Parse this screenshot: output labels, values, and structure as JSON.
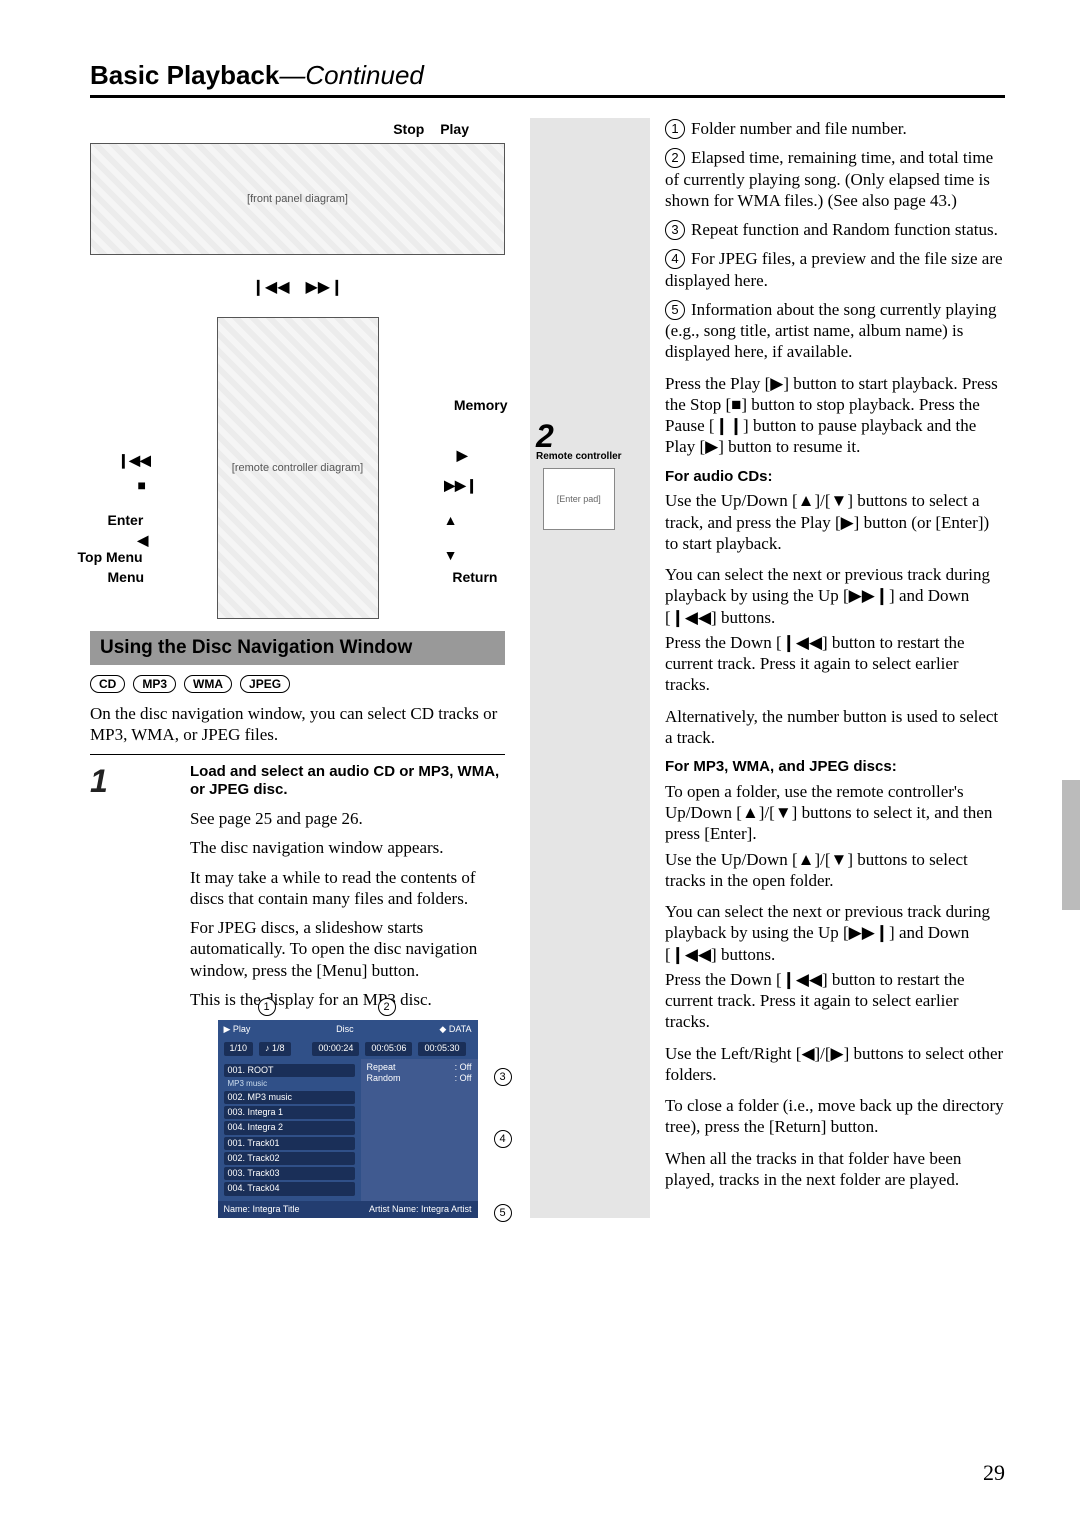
{
  "title_main": "Basic Playback",
  "title_cont": "—Continued",
  "labels": {
    "stop": "Stop",
    "play": "Play",
    "enter": "Enter",
    "top_menu": "Top Menu",
    "menu": "Menu",
    "memory": "Memory",
    "return": "Return",
    "remote_controller": "Remote controller"
  },
  "device_placeholder": "[front panel diagram]",
  "remote_placeholder": "[remote controller diagram]",
  "enter_img_placeholder": "[Enter pad]",
  "section_heading": "Using the Disc Navigation Window",
  "badges": [
    "CD",
    "MP3",
    "WMA",
    "JPEG"
  ],
  "intro": "On the disc navigation window, you can select CD tracks or MP3, WMA, or JPEG files.",
  "step1": {
    "num": "1",
    "head": "Load and select an audio CD or MP3, WMA, or JPEG disc.",
    "p1": "See page 25 and page 26.",
    "p2": "The disc navigation window appears.",
    "p3": "It may take a while to read the contents of discs that contain many files and folders.",
    "p4": "For JPEG discs, a slideshow starts automatically. To open the disc navigation window, press the [Menu] button.",
    "p5": "This is the display for an MP3 disc."
  },
  "nav_screen": {
    "top_left_play": "▶  Play",
    "top_disc": "Disc",
    "top_data": "◆ DATA",
    "track_box": "1/10",
    "file_box": "♪ 1/8",
    "time1": "00:00:24",
    "time2": "00:05:06",
    "time3": "00:05:30",
    "folder_root": "001. ROOT",
    "folder_label": "MP3 music",
    "items": [
      "002. MP3 music",
      "003. Integra 1",
      "004. Integra 2",
      "001. Track01",
      "002. Track02",
      "003. Track03",
      "004. Track04"
    ],
    "repeat_label": "Repeat",
    "repeat_val": ": Off",
    "random_label": "Random",
    "random_val": ": Off",
    "bottom_name": "Name: Integra Title",
    "bottom_artist": "Artist Name: Integra Artist"
  },
  "callouts": {
    "c1": "Folder number and file number.",
    "c2": "Elapsed time, remaining time, and total time of currently playing song. (Only elapsed time is shown for WMA files.) (See also page 43.)",
    "c3": "Repeat function and Random function status.",
    "c4": "For JPEG files, a preview and the file size are displayed here.",
    "c5": "Information about the song currently playing (e.g., song title, artist name, album name) is displayed here, if available."
  },
  "step2": {
    "num": "2",
    "p1": "Press the Play [▶] button to start playback. Press the Stop [■] button to stop playback. Press the Pause [❙❙] button to pause playback and the Play [▶] button to resume it.",
    "h_audio": "For audio CDs:",
    "a1": "Use the Up/Down [▲]/[▼] buttons to select a track, and press the Play [▶] button (or [Enter]) to start playback.",
    "a2": "You can select the next or previous track during playback by using the Up [▶▶❙] and Down [❙◀◀] buttons.",
    "a3": "Press the Down [❙◀◀] button to restart the current track. Press it again to select earlier tracks.",
    "a4": "Alternatively, the number button is used to select a track.",
    "h_mp3": "For MP3, WMA, and JPEG discs:",
    "m1": "To open a folder, use the remote controller's Up/Down [▲]/[▼] buttons to select it, and then press [Enter].",
    "m2": "Use the Up/Down [▲]/[▼] buttons to select tracks in the open folder.",
    "m3": "You can select the next or previous track during playback by using the Up [▶▶❙] and Down [❙◀◀] buttons.",
    "m4": "Press the Down [❙◀◀] button to restart the current track. Press it again to select earlier tracks.",
    "m5": "Use the Left/Right [◀]/[▶] buttons to select other folders.",
    "m6": "To close a folder (i.e., move back up the directory tree), press the [Return] button.",
    "m7": "When all the tracks in that folder have been played, tracks in the next folder are played."
  },
  "page_number": "29"
}
